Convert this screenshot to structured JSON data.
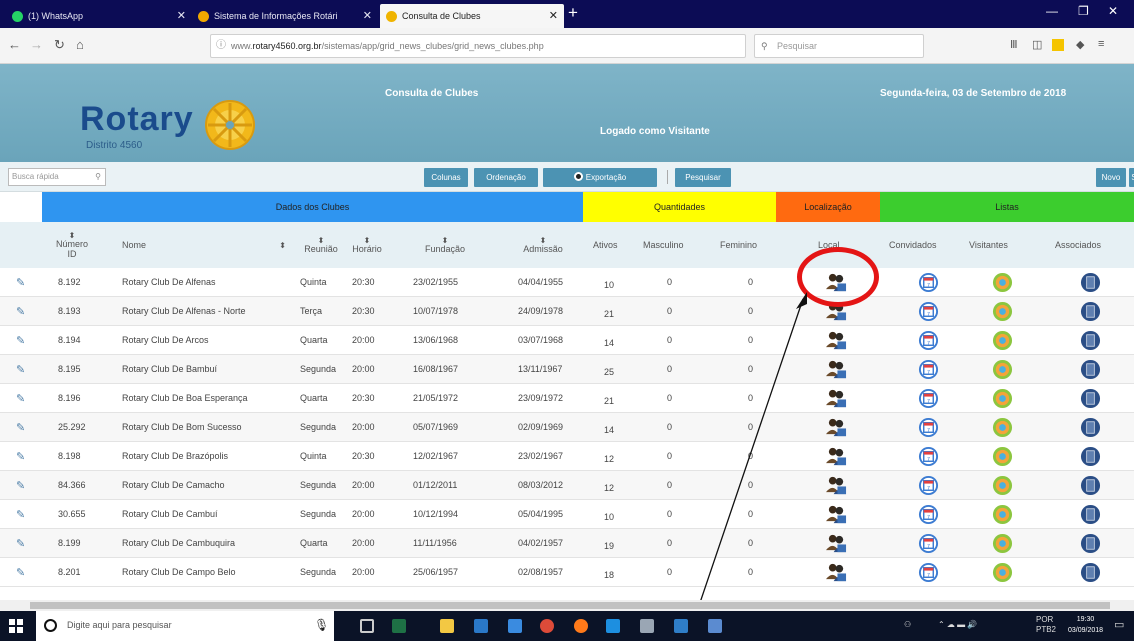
{
  "browser": {
    "tabs": [
      {
        "label": "(1) WhatsApp",
        "color": "#25d366"
      },
      {
        "label": "Sistema de Informações Rotári",
        "color": "#f0a800"
      },
      {
        "label": "Consulta de Clubes",
        "color": "#f0b400",
        "active": true
      }
    ],
    "url_prefix": "www.",
    "url_domain": "rotary4560.org.br",
    "url_path": "/sistemas/app/grid_news_clubes/grid_news_clubes.php",
    "url_icons": "··· ♡ ☆",
    "search_placeholder": "Pesquisar"
  },
  "site": {
    "logo_text": "Rotary",
    "logo_sub": "Distrito 4560",
    "page_title": "Consulta de Clubes",
    "logged_as": "Logado como Visitante",
    "date": "Segunda-feira, 03 de Setembro de 2018"
  },
  "toolbar": {
    "quick_search": "Busca rápida",
    "columns": "Colunas",
    "ordering": "Ordenação",
    "export": "Exportação",
    "search": "Pesquisar",
    "new": "Novo",
    "extra": "S"
  },
  "groups": {
    "club_data": "Dados dos Clubes",
    "quantities": "Quantidades",
    "location": "Localização",
    "lists": "Listas"
  },
  "columns": {
    "number": "Número ID",
    "name": "Nome",
    "meeting": "Reunião",
    "time": "Horário",
    "founded": "Fundação",
    "admitted": "Admissão",
    "active": "Ativos",
    "male": "Masculino",
    "female": "Feminino",
    "location": "Local",
    "guests": "Convidados",
    "visitors": "Visitantes",
    "members": "Associados"
  },
  "rows": [
    {
      "number": "8.192",
      "name": "Rotary Club De Alfenas",
      "meeting": "Quinta",
      "time": "20:30",
      "founded": "23/02/1955",
      "admitted": "04/04/1955",
      "active": "10",
      "male": "0",
      "female": "0"
    },
    {
      "number": "8.193",
      "name": "Rotary Club De Alfenas - Norte",
      "meeting": "Terça",
      "time": "20:30",
      "founded": "10/07/1978",
      "admitted": "24/09/1978",
      "active": "21",
      "male": "0",
      "female": "0"
    },
    {
      "number": "8.194",
      "name": "Rotary Club De Arcos",
      "meeting": "Quarta",
      "time": "20:00",
      "founded": "13/06/1968",
      "admitted": "03/07/1968",
      "active": "14",
      "male": "0",
      "female": "0"
    },
    {
      "number": "8.195",
      "name": "Rotary Club De Bambuí",
      "meeting": "Segunda",
      "time": "20:00",
      "founded": "16/08/1967",
      "admitted": "13/11/1967",
      "active": "25",
      "male": "0",
      "female": "0"
    },
    {
      "number": "8.196",
      "name": "Rotary Club De Boa Esperança",
      "meeting": "Quarta",
      "time": "20:30",
      "founded": "21/05/1972",
      "admitted": "23/09/1972",
      "active": "21",
      "male": "0",
      "female": "0"
    },
    {
      "number": "25.292",
      "name": "Rotary Club De Bom Sucesso",
      "meeting": "Segunda",
      "time": "20:00",
      "founded": "05/07/1969",
      "admitted": "02/09/1969",
      "active": "14",
      "male": "0",
      "female": "0"
    },
    {
      "number": "8.198",
      "name": "Rotary Club De Brazópolis",
      "meeting": "Quinta",
      "time": "20:30",
      "founded": "12/02/1967",
      "admitted": "23/02/1967",
      "active": "12",
      "male": "0",
      "female": "0"
    },
    {
      "number": "84.366",
      "name": "Rotary Club De Camacho",
      "meeting": "Segunda",
      "time": "20:00",
      "founded": "01/12/2011",
      "admitted": "08/03/2012",
      "active": "12",
      "male": "0",
      "female": "0"
    },
    {
      "number": "30.655",
      "name": "Rotary Club De Cambuí",
      "meeting": "Segunda",
      "time": "20:00",
      "founded": "10/12/1994",
      "admitted": "05/04/1995",
      "active": "10",
      "male": "0",
      "female": "0"
    },
    {
      "number": "8.199",
      "name": "Rotary Club De Cambuquira",
      "meeting": "Quarta",
      "time": "20:00",
      "founded": "11/11/1956",
      "admitted": "04/02/1957",
      "active": "19",
      "male": "0",
      "female": "0"
    },
    {
      "number": "8.201",
      "name": "Rotary Club De Campo Belo",
      "meeting": "Segunda",
      "time": "20:00",
      "founded": "25/06/1957",
      "admitted": "02/08/1957",
      "active": "18",
      "male": "0",
      "female": "0"
    }
  ],
  "colors": {
    "group_club_data": "#2f95f0",
    "group_quantities": "#ffff00",
    "group_location": "#ff6a10",
    "group_lists": "#3ccd2e",
    "header_bg": "#72aac0",
    "button": "#4c93b3",
    "annotation": "#e41515"
  },
  "icons": {
    "location": "people-location-icon",
    "guests": "calendar-icon",
    "visitors": "visitor-icon",
    "members": "members-book-icon"
  },
  "taskbar": {
    "search_placeholder": "Digite aqui para pesquisar",
    "lang": "POR",
    "lang2": "PTB2",
    "time": "19:30",
    "date": "03/09/2018"
  }
}
